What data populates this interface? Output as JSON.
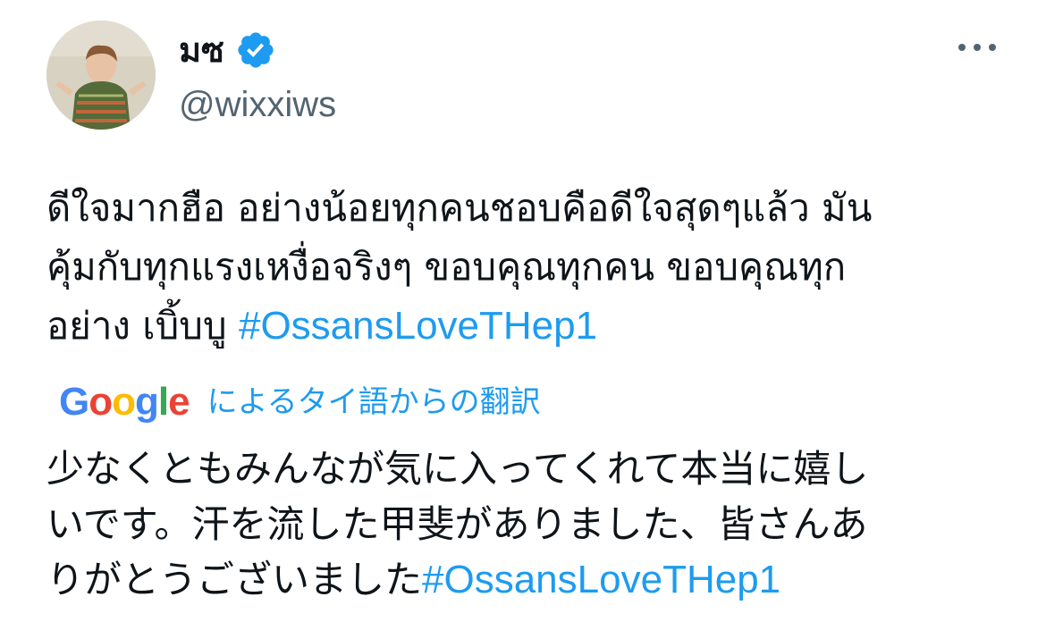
{
  "user": {
    "display_name": "มซ",
    "handle": "@wixxiws",
    "verified": true,
    "verified_color": "#1d9bf0",
    "avatar_icon": "profile-photo"
  },
  "menu": {
    "icon": "more-horizontal-icon"
  },
  "tweet": {
    "lines": [
      "ดีใจมากฮือ อย่างน้อยทุกคนชอบคือดีใจสุดๆแล้ว มัน",
      "คุ้มกับทุกแรงเหงื่อจริงๆ ขอบคุณทุกคน ขอบคุณทุก",
      "อย่าง เบิ้บบู "
    ],
    "hashtag": "#OssansLoveTHep1"
  },
  "translation": {
    "provider_letters": [
      "G",
      "o",
      "o",
      "g",
      "l",
      "e"
    ],
    "label": "によるタイ語からの翻訳",
    "lines": [
      "少なくともみんなが気に入ってくれて本当に嬉し",
      "いです。汗を流した甲斐がありました、皆さんあ",
      "りがとうございました"
    ],
    "hashtag": "#OssansLoveTHep1"
  },
  "colors": {
    "text": "#0f1419",
    "secondary": "#536471",
    "link": "#1d9bf0"
  }
}
